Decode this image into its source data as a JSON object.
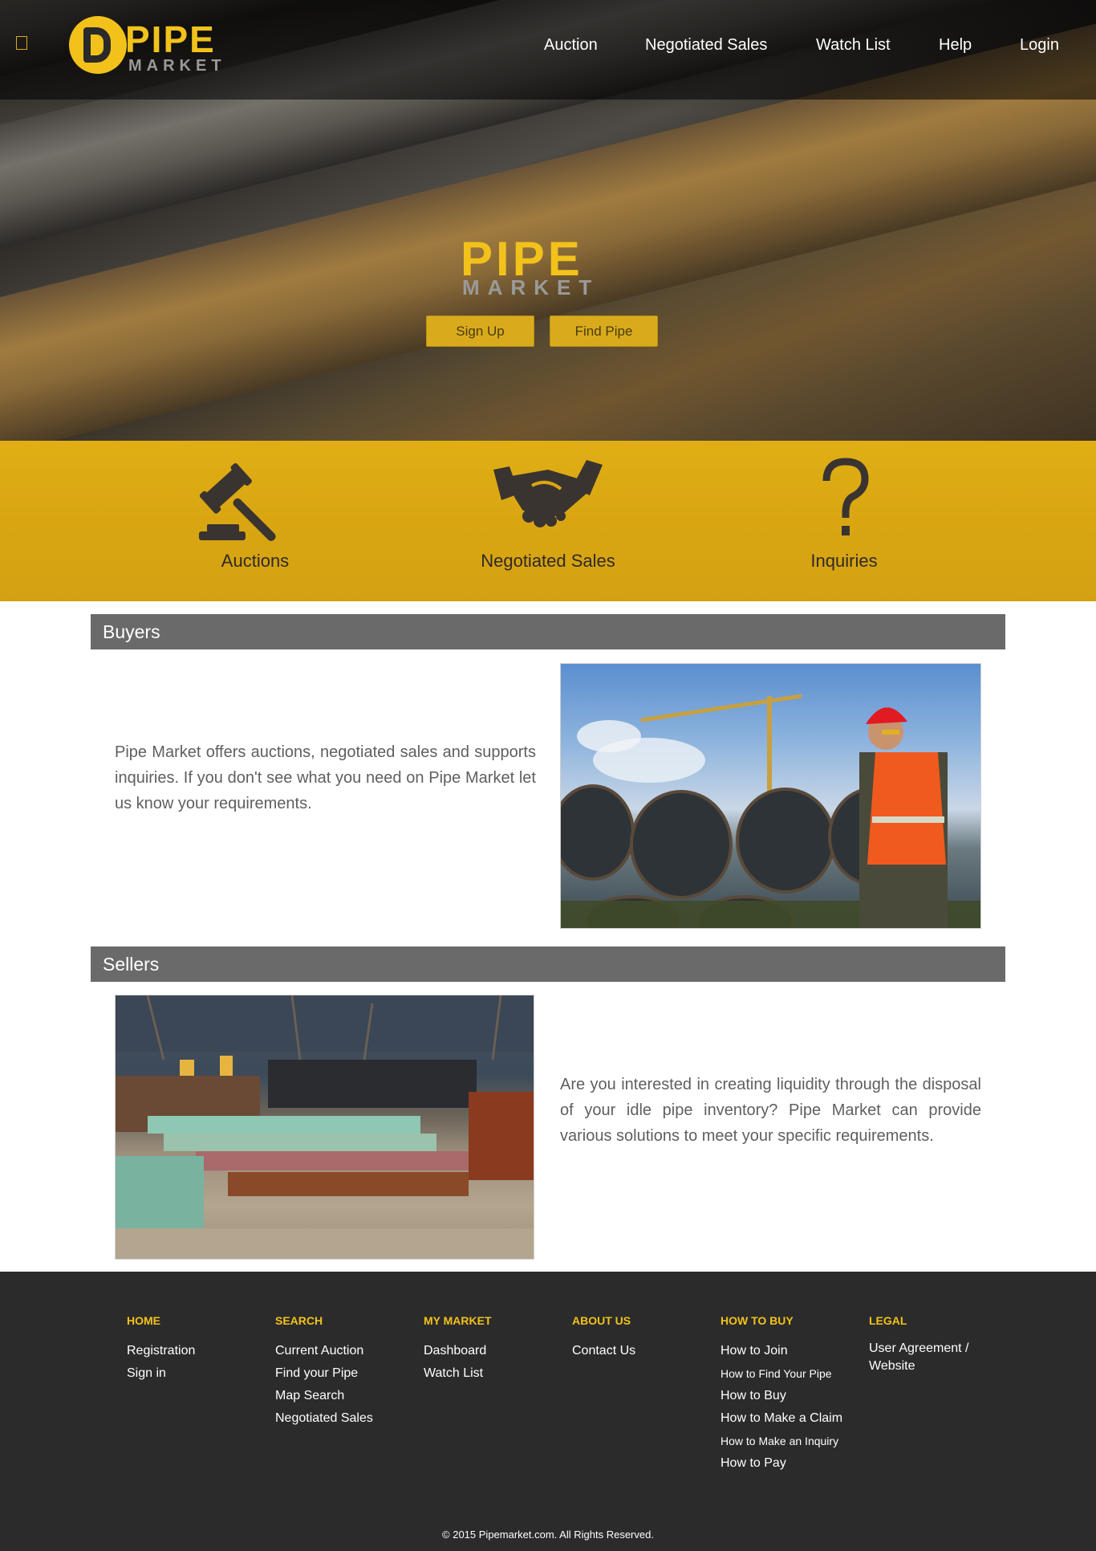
{
  "header": {
    "logo_text_top": "PIPE",
    "logo_text_bottom": "MARKET",
    "nav": {
      "auction": "Auction",
      "negotiated_sales": "Negotiated Sales",
      "watch_list": "Watch List",
      "help": "Help",
      "login": "Login"
    }
  },
  "hero": {
    "logo_text_top": "PIPE",
    "logo_text_bottom": "MARKET",
    "sign_up": "Sign Up",
    "find_pipe": "Find Pipe"
  },
  "features": {
    "auctions": "Auctions",
    "negotiated_sales": "Negotiated Sales",
    "inquiries": "Inquiries"
  },
  "buyers": {
    "title": "Buyers",
    "text": "Pipe Market offers auctions, negotiated sales and supports inquiries. If you don't see what you need on Pipe Market let us know your requirements."
  },
  "sellers": {
    "title": "Sellers",
    "text": "Are you interested in creating liquidity through the disposal of your idle pipe inventory? Pipe Market can provide various solutions to meet your specific requirements."
  },
  "footer": {
    "columns": [
      {
        "heading": "HOME",
        "links": [
          "Registration",
          "Sign in"
        ]
      },
      {
        "heading": "SEARCH",
        "links": [
          "Current Auction",
          "Find your Pipe",
          "Map Search",
          "Negotiated Sales"
        ]
      },
      {
        "heading": "MY MARKET",
        "links": [
          "Dashboard",
          "Watch List"
        ]
      },
      {
        "heading": "ABOUT US",
        "links": [
          "Contact Us"
        ]
      },
      {
        "heading": "HOW TO BUY",
        "links": [
          "How to Join",
          "How to Find Your Pipe",
          "How to Buy",
          "How to Make a Claim",
          "How to Make an Inquiry",
          "How to Pay"
        ]
      },
      {
        "heading": "LEGAL",
        "links": [
          "User Agreement / Website"
        ]
      }
    ],
    "copyright": "© 2015 Pipemarket.com. All Rights Reserved."
  },
  "colors": {
    "brand_yellow": "#f2c21b",
    "section_bar": "#6a6a6a",
    "footer_bg": "#2b2b2b"
  }
}
